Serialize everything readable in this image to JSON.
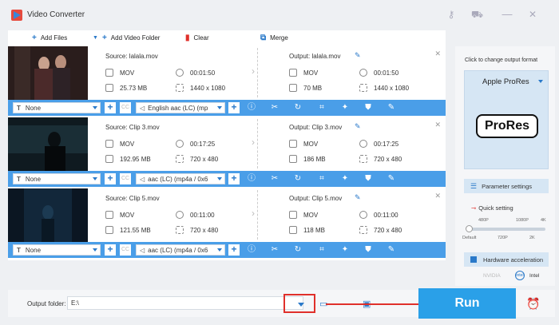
{
  "app": {
    "title": "Video Converter"
  },
  "toolbar": {
    "add_files": "Add Files",
    "add_video_folder": "Add Video Folder",
    "clear": "Clear",
    "merge": "Merge"
  },
  "items": [
    {
      "source": "Source: lalala.mov",
      "src_format": "MOV",
      "src_duration": "00:01:50",
      "src_size": "25.73 MB",
      "src_resolution": "1440 x 1080",
      "output": "Output: lalala.mov",
      "out_format": "MOV",
      "out_duration": "00:01:50",
      "out_size": "70 MB",
      "out_resolution": "1440 x 1080",
      "subtitle": "None",
      "audio": "English aac (LC) (mp"
    },
    {
      "source": "Source: Clip 3.mov",
      "src_format": "MOV",
      "src_duration": "00:17:25",
      "src_size": "192.95 MB",
      "src_resolution": "720 x 480",
      "output": "Output: Clip 3.mov",
      "out_format": "MOV",
      "out_duration": "00:17:25",
      "out_size": "186 MB",
      "out_resolution": "720 x 480",
      "subtitle": "None",
      "audio": "aac (LC) (mp4a / 0x6"
    },
    {
      "source": "Source: Clip 5.mov",
      "src_format": "MOV",
      "src_duration": "00:11:00",
      "src_size": "121.55 MB",
      "src_resolution": "720 x 480",
      "output": "Output: Clip 5.mov",
      "out_format": "MOV",
      "out_duration": "00:11:00",
      "out_size": "118 MB",
      "out_resolution": "720 x 480",
      "subtitle": "None",
      "audio": "aac (LC) (mp4a / 0x6"
    }
  ],
  "sidebar": {
    "hint": "Click to change output format",
    "format_name": "Apple ProRes",
    "format_logo": "ProRes",
    "parameter_settings": "Parameter settings",
    "quick_setting": "Quick setting",
    "ticks_top": [
      "480P",
      "1080P",
      "4K"
    ],
    "ticks_bottom": [
      "Default",
      "720P",
      "2K"
    ],
    "hardware_acceleration": "Hardware acceleration",
    "vendor_nvidia": "NVIDIA",
    "vendor_intel": "Intel"
  },
  "bottom": {
    "output_folder_label": "Output folder:",
    "output_folder_value": "E:\\",
    "run": "Run"
  },
  "colors": {
    "accent": "#4a9ee8",
    "run": "#2aa0e8",
    "highlight": "#e0302b"
  }
}
